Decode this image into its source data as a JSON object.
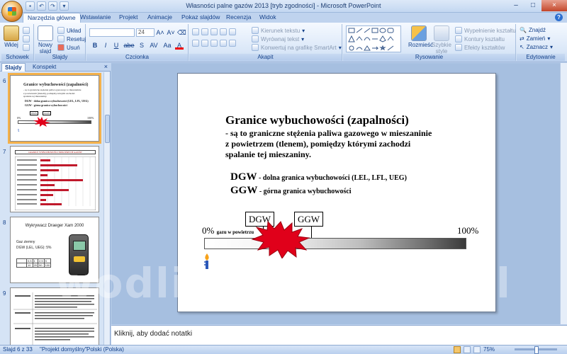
{
  "window": {
    "title": "Własności palne gazów 2013 [tryb zgodności] - Microsoft PowerPoint",
    "controls": [
      "–",
      "□",
      "×"
    ]
  },
  "ribbon_tabs": [
    "Narzędzia główne",
    "Wstawianie",
    "Projekt",
    "Animacje",
    "Pokaz slajdów",
    "Recenzja",
    "Widok"
  ],
  "ribbon": {
    "clipboard": {
      "paste": "Wklej",
      "group": "Schowek"
    },
    "slides": {
      "new_slide": "Nowy slajd",
      "layout": "Układ",
      "reset": "Resetuj",
      "delete": "Usuń",
      "group": "Slajdy"
    },
    "font": {
      "size": "24",
      "group": "Czcionka",
      "buttons": [
        "B",
        "I",
        "U",
        "abe",
        "S",
        "AV",
        "Aa",
        "A"
      ]
    },
    "paragraph": {
      "text_direction": "Kierunek tekstu",
      "align_text": "Wyrównaj tekst",
      "smartart": "Konwertuj na grafikę SmartArt",
      "group": "Akapit"
    },
    "drawing": {
      "arrange": "Rozmieść",
      "quick_styles": "Szybkie style",
      "fill": "Wypełnienie kształtu",
      "outline": "Kontury kształtu",
      "effects": "Efekty kształtów",
      "group": "Rysowanie"
    },
    "editing": {
      "find": "Znajdź",
      "replace": "Zamień",
      "select": "Zaznacz",
      "group": "Edytowanie"
    }
  },
  "pane": {
    "tabs": [
      "Slajdy",
      "Konspekt"
    ],
    "close": "×",
    "slides": [
      {
        "num": "6",
        "title": "Granice wybuchowości (zapalności)",
        "lines": [
          "- są to graniczne stężenia paliwa gazowego w mieszaninie",
          "z powietrzem (tlenem), pomiędzy którymi zachodzi",
          "spalanie tej mieszaniny."
        ],
        "dgw": "DGW - dolna granica wybuchowości (LEL, LFL, UEG)",
        "ggw": "GGW - górna granica wybuchowości",
        "box_left": "DGW",
        "box_right": "GGW",
        "p0": "0%",
        "p100": "100%"
      },
      {
        "num": "7",
        "header": "GRANICE WYBUCHOWOŚCI NIEKTÓRYCH GAZÓW"
      },
      {
        "num": "8",
        "title": "Wykrywacz Draeger Xam 2000",
        "gas": "Gaz ziemny",
        "lel": "DGW (LEL, UEG): 5%",
        "table": [
          [
            "0,5",
            "1",
            "2,5",
            "5"
          ],
          [
            "10",
            "20",
            "50",
            "100"
          ]
        ]
      },
      {
        "num": "9"
      }
    ]
  },
  "slide": {
    "title": "Granice wybuchowości (zapalności)",
    "body": [
      "- są to graniczne stężenia paliwa gazowego w mieszaninie",
      "z powietrzem (tlenem), pomiędzy którymi zachodzi",
      "spalanie tej mieszaniny."
    ],
    "dgw_abbr": "DGW",
    "dgw_desc": " - dolna granica wybuchowości  (LEL, LFL, UEG)",
    "ggw_abbr": "GGW",
    "ggw_desc": " - górna granica wybuchowości",
    "label_dgw": "DGW",
    "label_ggw": "GGW",
    "pct_start": "0%",
    "pct_start_note": "gazu w powietrzu",
    "pct_end": "100%"
  },
  "notes": {
    "placeholder": "Kliknij, aby dodać notatki"
  },
  "status": {
    "slide": "Slajd 6 z 33",
    "theme": "\"Projekt domyślny\"",
    "language": "Polski (Polska)",
    "zoom": "75%"
  },
  "watermark": "wodlinydomowe.pl",
  "colors": {
    "accent": "#15428b",
    "explosion": "#e0001a",
    "selection": "#f4b14b"
  }
}
